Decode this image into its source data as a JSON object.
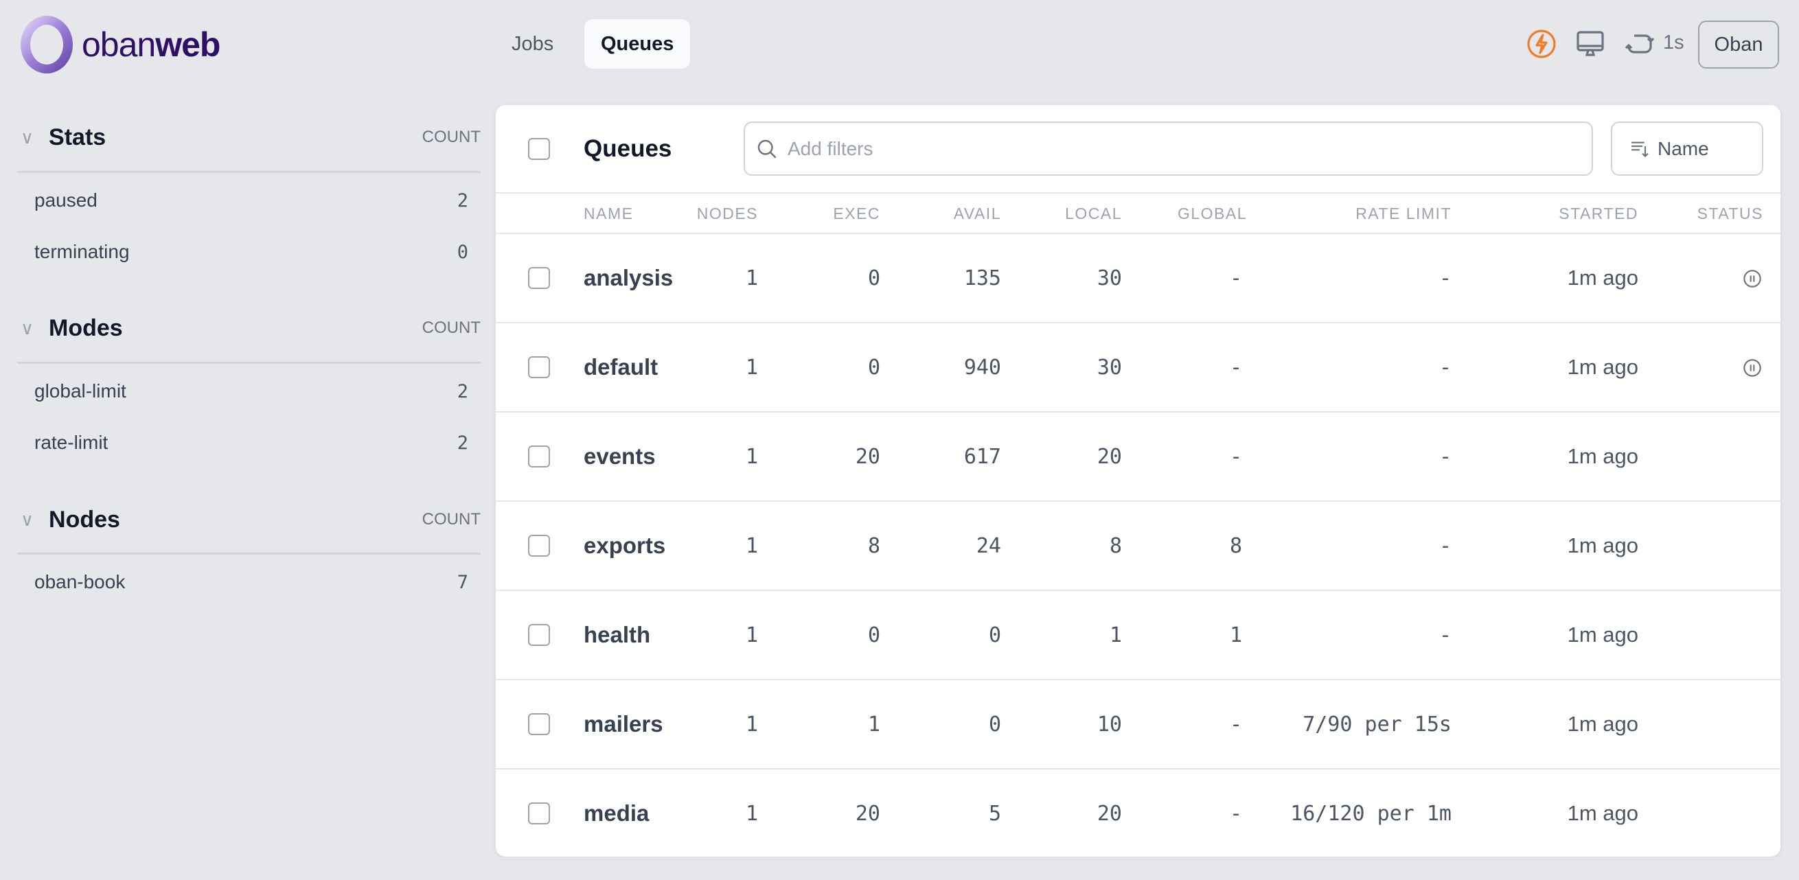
{
  "brand": {
    "logo_text_light": "oban",
    "logo_text_bold": "web"
  },
  "nav": {
    "tabs": [
      {
        "label": "Jobs",
        "active": false
      },
      {
        "label": "Queues",
        "active": true
      }
    ]
  },
  "header": {
    "refresh_interval": "1s",
    "instance_button": "Oban",
    "accent_color": "#f07d2c",
    "icons": [
      "bolt-icon",
      "monitor-icon",
      "refresh-icon"
    ]
  },
  "sidebar": {
    "sections": [
      {
        "title": "Stats",
        "count_label": "COUNT",
        "items": [
          {
            "label": "paused",
            "count": "2"
          },
          {
            "label": "terminating",
            "count": "0"
          }
        ]
      },
      {
        "title": "Modes",
        "count_label": "COUNT",
        "items": [
          {
            "label": "global-limit",
            "count": "2"
          },
          {
            "label": "rate-limit",
            "count": "2"
          }
        ]
      },
      {
        "title": "Nodes",
        "count_label": "COUNT",
        "items": [
          {
            "label": "oban-book",
            "count": "7"
          }
        ]
      }
    ]
  },
  "main": {
    "title": "Queues",
    "search": {
      "placeholder": "Add filters",
      "value": ""
    },
    "sort": {
      "label": "Name"
    },
    "columns": [
      "Name",
      "Nodes",
      "Exec",
      "Avail",
      "Local",
      "Global",
      "Rate Limit",
      "Started",
      "Status"
    ],
    "rows": [
      {
        "name": "analysis",
        "nodes": "1",
        "exec": "0",
        "avail": "135",
        "local": "30",
        "global": "-",
        "rate_limit": "-",
        "started": "1m ago",
        "status": "paused"
      },
      {
        "name": "default",
        "nodes": "1",
        "exec": "0",
        "avail": "940",
        "local": "30",
        "global": "-",
        "rate_limit": "-",
        "started": "1m ago",
        "status": "paused"
      },
      {
        "name": "events",
        "nodes": "1",
        "exec": "20",
        "avail": "617",
        "local": "20",
        "global": "-",
        "rate_limit": "-",
        "started": "1m ago",
        "status": ""
      },
      {
        "name": "exports",
        "nodes": "1",
        "exec": "8",
        "avail": "24",
        "local": "8",
        "global": "8",
        "rate_limit": "-",
        "started": "1m ago",
        "status": ""
      },
      {
        "name": "health",
        "nodes": "1",
        "exec": "0",
        "avail": "0",
        "local": "1",
        "global": "1",
        "rate_limit": "-",
        "started": "1m ago",
        "status": ""
      },
      {
        "name": "mailers",
        "nodes": "1",
        "exec": "1",
        "avail": "0",
        "local": "10",
        "global": "-",
        "rate_limit": "7/90 per 15s",
        "started": "1m ago",
        "status": ""
      },
      {
        "name": "media",
        "nodes": "1",
        "exec": "20",
        "avail": "5",
        "local": "20",
        "global": "-",
        "rate_limit": "16/120 per 1m",
        "started": "1m ago",
        "status": ""
      }
    ]
  }
}
